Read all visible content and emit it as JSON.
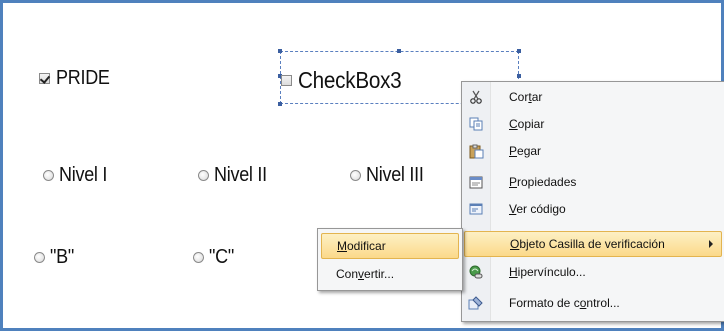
{
  "controls": {
    "pride": {
      "label": "PRIDE",
      "checked": true
    },
    "checkbox3": {
      "label": "CheckBox3",
      "checked": false
    },
    "nivel1": {
      "label": "Nivel I"
    },
    "nivel2": {
      "label": "Nivel II"
    },
    "nivel3": {
      "label": "Nivel III"
    },
    "b": {
      "label": "\"B\""
    },
    "c": {
      "label": "\"C\""
    }
  },
  "context_menu": {
    "items": [
      {
        "icon": "scissors-icon",
        "label": "Cortar",
        "accel_pre": "Cor",
        "accel": "t",
        "accel_post": "ar"
      },
      {
        "icon": "copy-icon",
        "label": "Copiar",
        "accel_pre": "",
        "accel": "C",
        "accel_post": "opiar"
      },
      {
        "icon": "paste-icon",
        "label": "Pegar",
        "accel_pre": "",
        "accel": "P",
        "accel_post": "egar"
      },
      {
        "icon": "properties-icon",
        "label": "Propiedades",
        "accel_pre": "",
        "accel": "P",
        "accel_post": "ropiedades"
      },
      {
        "icon": "view-code-icon",
        "label": "Ver código",
        "accel_pre": "",
        "accel": "V",
        "accel_post": "er código"
      },
      {
        "icon": "",
        "label": "Objeto Casilla de verificación",
        "accel_pre": "",
        "accel": "O",
        "accel_post": "bjeto Casilla de verificación"
      },
      {
        "icon": "hyperlink-icon",
        "label": "Hipervínculo...",
        "accel_pre": "",
        "accel": "H",
        "accel_post": "ipervínculo..."
      },
      {
        "icon": "format-control-icon",
        "label": "Formato de control...",
        "accel_pre": "Formato de c",
        "accel": "o",
        "accel_post": "ntrol..."
      }
    ]
  },
  "submenu": {
    "items": [
      {
        "label": "Modificar",
        "accel_pre": "",
        "accel": "M",
        "accel_post": "odificar"
      },
      {
        "label": "Convertir...",
        "accel_pre": "Con",
        "accel": "v",
        "accel_post": "ertir..."
      }
    ]
  },
  "colors": {
    "frame": "#4f81bd",
    "highlight": "#fbd98a",
    "selection": "#5a7fbf"
  }
}
